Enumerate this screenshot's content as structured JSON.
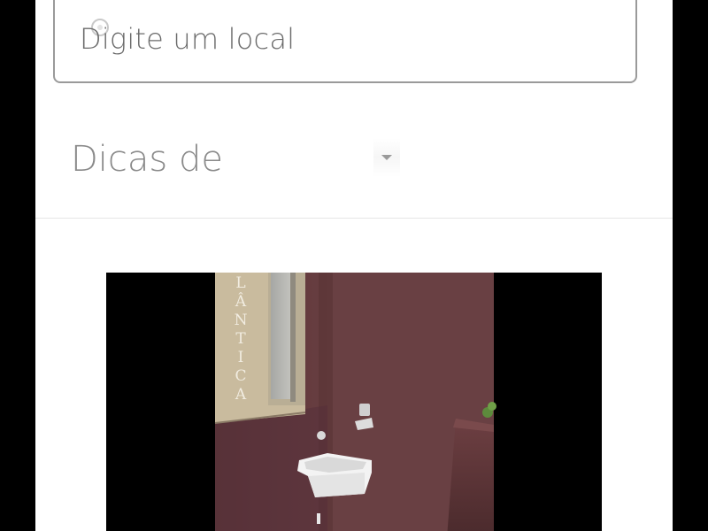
{
  "search": {
    "location_placeholder": "Digite um local",
    "icon": "location-pin-icon"
  },
  "tips": {
    "label": "Dicas de",
    "icon": "chevron-down-icon"
  },
  "photo": {
    "wall_lettering": [
      "L",
      "Â",
      "N",
      "T",
      "I",
      "C",
      "A"
    ]
  },
  "colors": {
    "page_background": "#000000",
    "panel_background": "#ffffff",
    "field_border": "#9a9a9a",
    "text_muted": "#8a8a8a",
    "divider": "#e6e6e6"
  }
}
